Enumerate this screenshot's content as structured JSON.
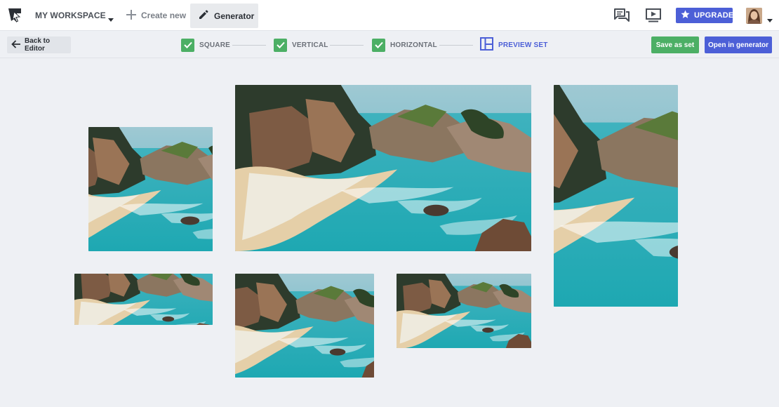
{
  "topbar": {
    "workspace_label": "MY WORKSPACE",
    "create_new_label": "Create new",
    "generator_label": "Generator",
    "upgrade_label": "UPGRADE"
  },
  "stepbar": {
    "back_label": "Back to Editor",
    "steps": [
      {
        "label": "SQUARE",
        "done": true
      },
      {
        "label": "VERTICAL",
        "done": true
      },
      {
        "label": "HORIZONTAL",
        "done": true
      },
      {
        "label": "PREVIEW SET",
        "done": false,
        "active": true
      }
    ],
    "save_label": "Save as set",
    "open_label": "Open in generator"
  },
  "colors": {
    "accent": "#4c5fd7",
    "success": "#4caf65",
    "background": "#eef0f4"
  },
  "previews": [
    {
      "name": "square-preview",
      "format": "square"
    },
    {
      "name": "landscape-large-preview",
      "format": "horizontal"
    },
    {
      "name": "vertical-preview",
      "format": "vertical"
    },
    {
      "name": "banner-preview",
      "format": "horizontal"
    },
    {
      "name": "portrait-preview",
      "format": "vertical"
    },
    {
      "name": "landscape-small-preview",
      "format": "horizontal"
    }
  ]
}
